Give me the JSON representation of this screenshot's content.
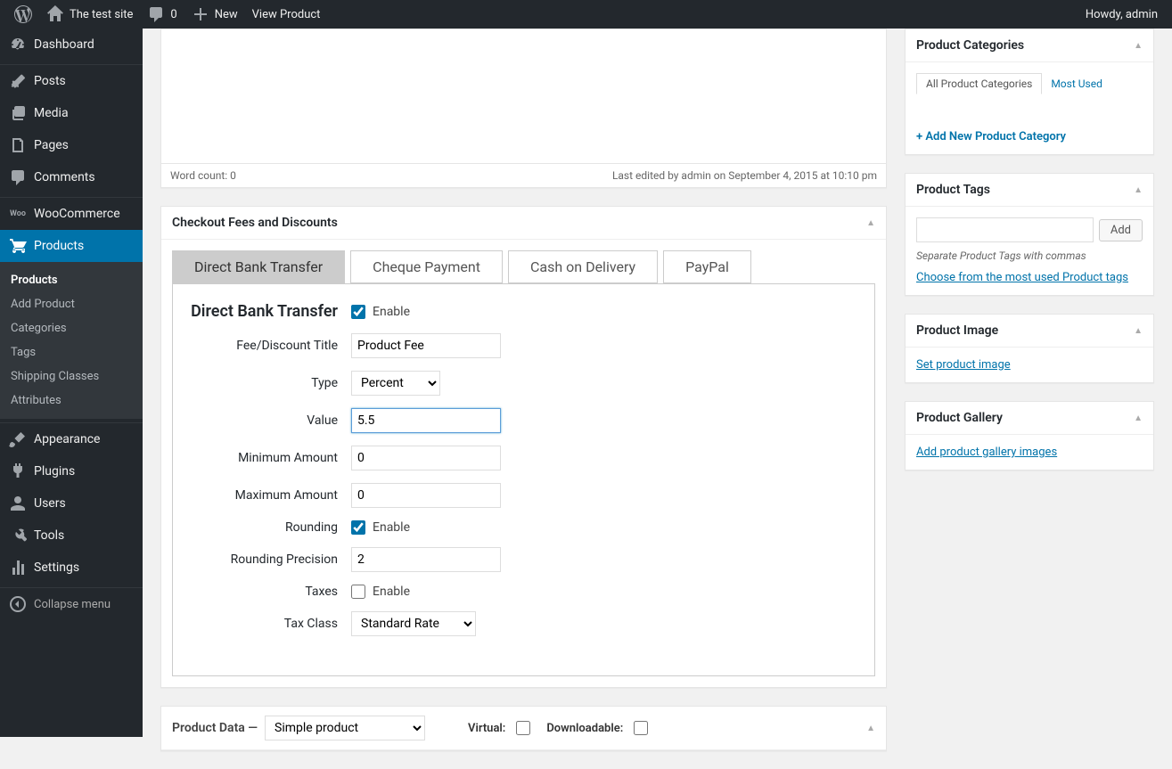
{
  "adminbar": {
    "site_title": "The test site",
    "comments_count": "0",
    "new_label": "New",
    "view_product": "View Product",
    "howdy": "Howdy, admin"
  },
  "sidebar": {
    "dashboard": "Dashboard",
    "posts": "Posts",
    "media": "Media",
    "pages": "Pages",
    "comments": "Comments",
    "woocommerce": "WooCommerce",
    "products": "Products",
    "submenu": {
      "products": "Products",
      "add_product": "Add Product",
      "categories": "Categories",
      "tags": "Tags",
      "shipping_classes": "Shipping Classes",
      "attributes": "Attributes"
    },
    "appearance": "Appearance",
    "plugins": "Plugins",
    "users": "Users",
    "tools": "Tools",
    "settings": "Settings",
    "collapse": "Collapse menu"
  },
  "editor": {
    "word_count_label": "Word count: 0",
    "last_edited": "Last edited by admin on September 4, 2015 at 10:10 pm"
  },
  "checkout_box": {
    "title": "Checkout Fees and Discounts",
    "tabs": [
      "Direct Bank Transfer",
      "Cheque Payment",
      "Cash on Delivery",
      "PayPal"
    ],
    "panel": {
      "heading": "Direct Bank Transfer",
      "enable_label": "Enable",
      "enable_checked": true,
      "fields": {
        "title_label": "Fee/Discount Title",
        "title_value": "Product Fee",
        "type_label": "Type",
        "type_value": "Percent",
        "value_label": "Value",
        "value_value": "5.5",
        "min_label": "Minimum Amount",
        "min_value": "0",
        "max_label": "Maximum Amount",
        "max_value": "0",
        "rounding_label": "Rounding",
        "rounding_enable": "Enable",
        "rounding_checked": true,
        "precision_label": "Rounding Precision",
        "precision_value": "2",
        "taxes_label": "Taxes",
        "taxes_enable": "Enable",
        "taxes_checked": false,
        "tax_class_label": "Tax Class",
        "tax_class_value": "Standard Rate"
      }
    }
  },
  "product_data": {
    "title": "Product Data —",
    "select_value": "Simple product",
    "virtual_label": "Virtual:",
    "downloadable_label": "Downloadable:"
  },
  "side": {
    "categories": {
      "title": "Product Categories",
      "tab_all": "All Product Categories",
      "tab_most": "Most Used",
      "add_new": "+ Add New Product Category"
    },
    "tags": {
      "title": "Product Tags",
      "add_button": "Add",
      "hint": "Separate Product Tags with commas",
      "choose_link": "Choose from the most used Product tags"
    },
    "image": {
      "title": "Product Image",
      "set_link": "Set product image"
    },
    "gallery": {
      "title": "Product Gallery",
      "add_link": "Add product gallery images"
    }
  }
}
